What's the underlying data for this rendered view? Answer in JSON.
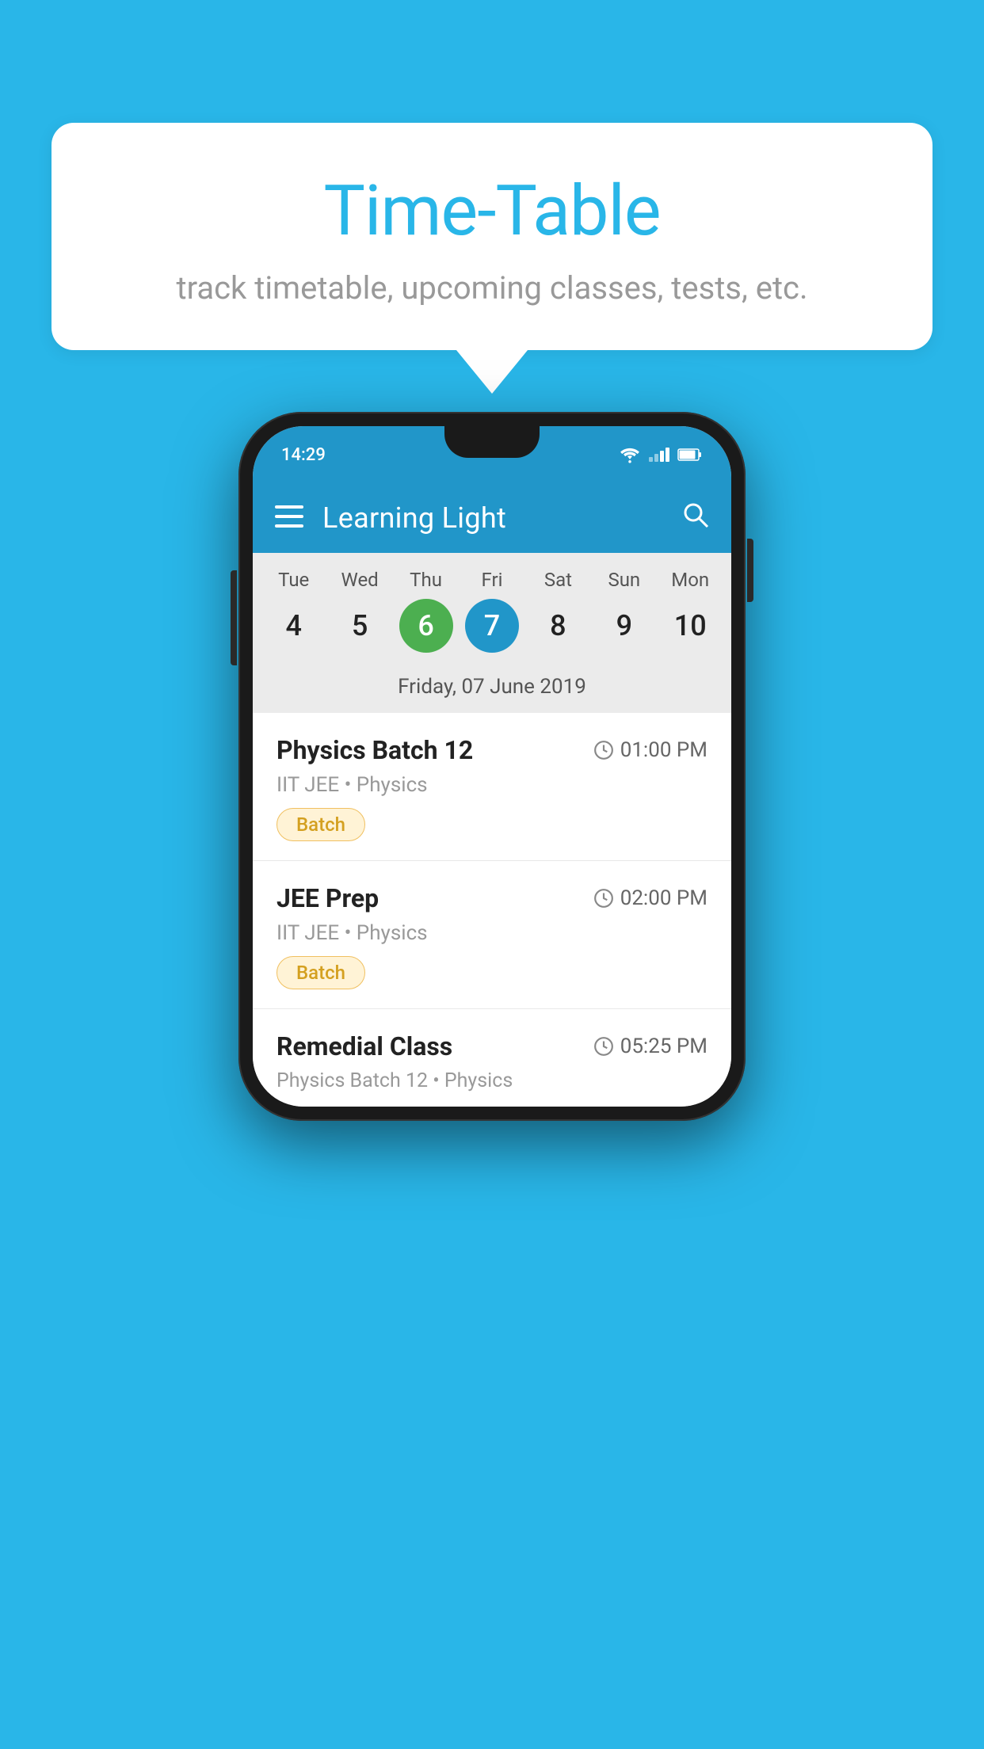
{
  "background_color": "#29b6e8",
  "speech_bubble": {
    "title": "Time-Table",
    "subtitle": "track timetable, upcoming classes, tests, etc."
  },
  "phone": {
    "status_bar": {
      "time": "14:29"
    },
    "app_header": {
      "title": "Learning Light"
    },
    "calendar": {
      "days": [
        {
          "name": "Tue",
          "num": "4",
          "state": "normal"
        },
        {
          "name": "Wed",
          "num": "5",
          "state": "normal"
        },
        {
          "name": "Thu",
          "num": "6",
          "state": "today"
        },
        {
          "name": "Fri",
          "num": "7",
          "state": "selected"
        },
        {
          "name": "Sat",
          "num": "8",
          "state": "normal"
        },
        {
          "name": "Sun",
          "num": "9",
          "state": "normal"
        },
        {
          "name": "Mon",
          "num": "10",
          "state": "normal"
        }
      ],
      "selected_date_label": "Friday, 07 June 2019"
    },
    "schedule_items": [
      {
        "title": "Physics Batch 12",
        "time": "01:00 PM",
        "sub": "IIT JEE • Physics",
        "badge": "Batch"
      },
      {
        "title": "JEE Prep",
        "time": "02:00 PM",
        "sub": "IIT JEE • Physics",
        "badge": "Batch"
      },
      {
        "title": "Remedial Class",
        "time": "05:25 PM",
        "sub": "Physics Batch 12 • Physics",
        "badge": null
      }
    ]
  }
}
